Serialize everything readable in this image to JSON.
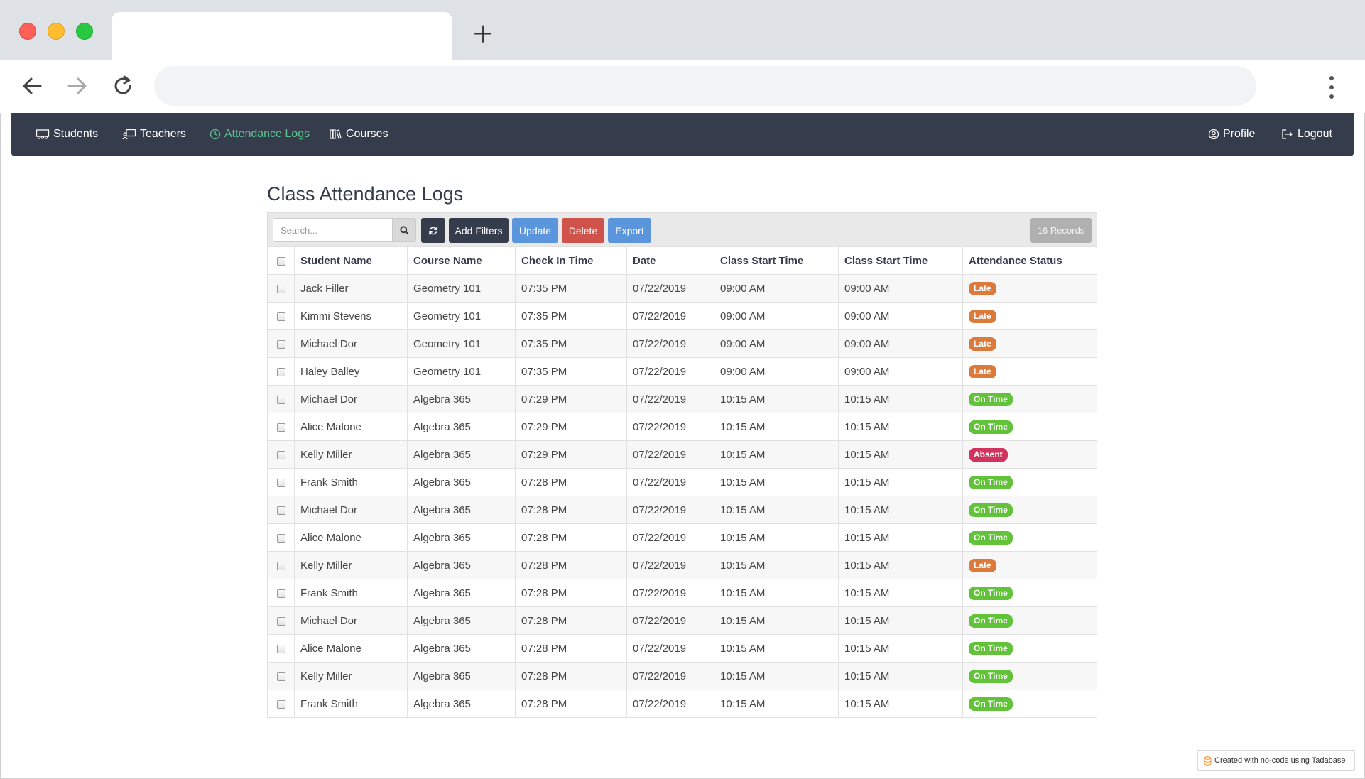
{
  "browser": {
    "tab_title": "",
    "new_tab_label": "+",
    "address": ""
  },
  "nav": {
    "items": [
      {
        "label": "Students",
        "icon": "students-icon"
      },
      {
        "label": "Teachers",
        "icon": "teacher-icon"
      },
      {
        "label": "Attendance Logs",
        "icon": "clock-icon",
        "active": true
      },
      {
        "label": "Courses",
        "icon": "books-icon"
      }
    ],
    "right": [
      {
        "label": "Profile",
        "icon": "user-circle-icon"
      },
      {
        "label": "Logout",
        "icon": "logout-icon"
      }
    ],
    "active_color": "#5ec28f",
    "bg_color": "#353d4d"
  },
  "page": {
    "title": "Class Attendance Logs"
  },
  "toolbar": {
    "search_placeholder": "Search...",
    "add_filters": "Add Filters",
    "update": "Update",
    "delete": "Delete",
    "export": "Export",
    "records": "16 Records"
  },
  "table": {
    "columns": [
      "Student Name",
      "Course Name",
      "Check In Time",
      "Date",
      "Class Start Time",
      "Class Start Time",
      "Attendance Status"
    ],
    "rows": [
      [
        "Jack Filler",
        "Geometry 101",
        "07:35 PM",
        "07/22/2019",
        "09:00 AM",
        "09:00 AM",
        "Late"
      ],
      [
        "Kimmi Stevens",
        "Geometry 101",
        "07:35 PM",
        "07/22/2019",
        "09:00 AM",
        "09:00 AM",
        "Late"
      ],
      [
        "Michael Dor",
        "Geometry 101",
        "07:35 PM",
        "07/22/2019",
        "09:00 AM",
        "09:00 AM",
        "Late"
      ],
      [
        "Haley Balley",
        "Geometry 101",
        "07:35 PM",
        "07/22/2019",
        "09:00 AM",
        "09:00 AM",
        "Late"
      ],
      [
        "Michael Dor",
        "Algebra 365",
        "07:29 PM",
        "07/22/2019",
        "10:15 AM",
        "10:15 AM",
        "On Time"
      ],
      [
        "Alice Malone",
        "Algebra 365",
        "07:29 PM",
        "07/22/2019",
        "10:15 AM",
        "10:15 AM",
        "On Time"
      ],
      [
        "Kelly Miller",
        "Algebra 365",
        "07:29 PM",
        "07/22/2019",
        "10:15 AM",
        "10:15 AM",
        "Absent"
      ],
      [
        "Frank Smith",
        "Algebra 365",
        "07:28 PM",
        "07/22/2019",
        "10:15 AM",
        "10:15 AM",
        "On Time"
      ],
      [
        "Michael Dor",
        "Algebra 365",
        "07:28 PM",
        "07/22/2019",
        "10:15 AM",
        "10:15 AM",
        "On Time"
      ],
      [
        "Alice Malone",
        "Algebra 365",
        "07:28 PM",
        "07/22/2019",
        "10:15 AM",
        "10:15 AM",
        "On Time"
      ],
      [
        "Kelly Miller",
        "Algebra 365",
        "07:28 PM",
        "07/22/2019",
        "10:15 AM",
        "10:15 AM",
        "Late"
      ],
      [
        "Frank Smith",
        "Algebra 365",
        "07:28 PM",
        "07/22/2019",
        "10:15 AM",
        "10:15 AM",
        "On Time"
      ],
      [
        "Michael Dor",
        "Algebra 365",
        "07:28 PM",
        "07/22/2019",
        "10:15 AM",
        "10:15 AM",
        "On Time"
      ],
      [
        "Alice Malone",
        "Algebra 365",
        "07:28 PM",
        "07/22/2019",
        "10:15 AM",
        "10:15 AM",
        "On Time"
      ],
      [
        "Kelly Miller",
        "Algebra 365",
        "07:28 PM",
        "07/22/2019",
        "10:15 AM",
        "10:15 AM",
        "On Time"
      ],
      [
        "Frank Smith",
        "Algebra 365",
        "07:28 PM",
        "07/22/2019",
        "10:15 AM",
        "10:15 AM",
        "On Time"
      ]
    ],
    "status_colors": {
      "Late": "#dc7a3c",
      "On Time": "#62c33b",
      "Absent": "#d0335e"
    }
  },
  "footer": {
    "credit": "Created with no-code using Tadabase"
  }
}
